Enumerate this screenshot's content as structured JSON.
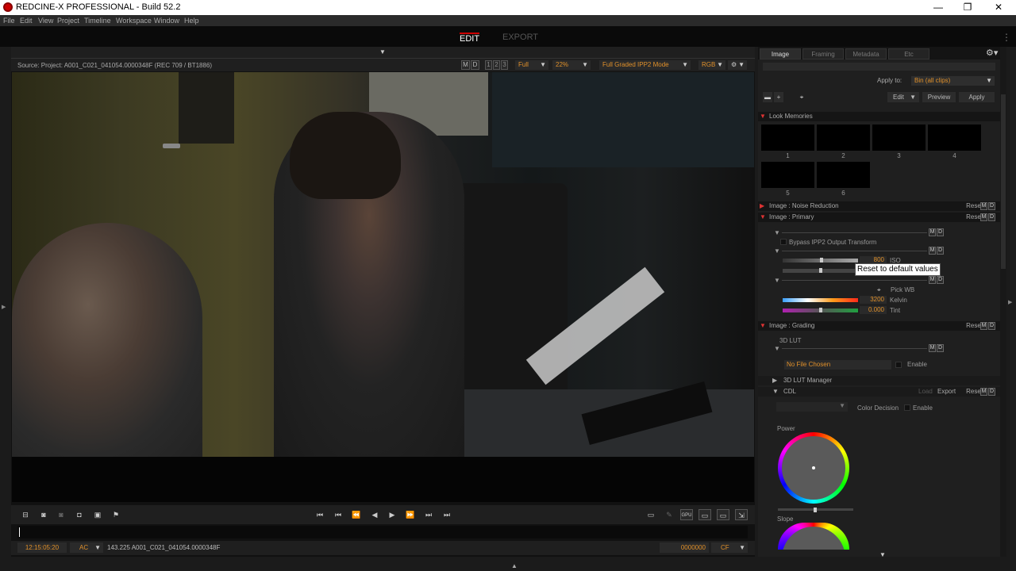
{
  "window": {
    "title": "REDCINE-X PROFESSIONAL - Build 52.2",
    "minimize": "—",
    "maximize": "❐",
    "close": "✕"
  },
  "menu": [
    "File",
    "Edit",
    "View",
    "Project",
    "Timeline",
    "Workspace",
    "Window",
    "Help"
  ],
  "modes": {
    "edit": "EDIT",
    "export": "EXPORT"
  },
  "viewer": {
    "source": "Source: Project: A001_C021_041054.0000348F   (REC 709 / BT1886)",
    "m": "M",
    "d": "D",
    "n1": "1",
    "n2": "2",
    "n3": "3",
    "resolution": "Full",
    "zoom": "22%",
    "mode": "Full Graded IPP2 Mode",
    "color": "RGB"
  },
  "footer": {
    "timecode": "12:15:05:20",
    "ac": "AC",
    "clipinfo": "143.225 A001_C021_041054.0000348F",
    "frame": "0000000",
    "cf": "CF"
  },
  "panel": {
    "tabs": [
      "Image",
      "Framing",
      "Metadata",
      "Etc"
    ],
    "apply_to_label": "Apply to:",
    "apply_to_value": "Bin (all clips)",
    "edit": "Edit",
    "preview": "Preview",
    "apply": "Apply",
    "look_memories": "Look Memories",
    "memories": [
      "1",
      "2",
      "3",
      "4",
      "5",
      "6"
    ],
    "noise": "Image : Noise Reduction",
    "primary": "Image : Primary",
    "grading": "Image : Grading",
    "reset": "Reset",
    "bypass": "Bypass IPP2 Output Transform",
    "iso_value": "800",
    "iso_label": "ISO",
    "pick_wb": "Pick WB",
    "kelvin_value": "3200",
    "kelvin_label": "Kelvin",
    "tint_value": "0.000",
    "tint_label": "Tint",
    "lut_3d": "3D LUT",
    "lut_file": "No File Chosen",
    "enable": "Enable",
    "lut_manager": "3D LUT Manager",
    "cdl": "CDL",
    "load": "Load",
    "export": "Export",
    "color_decision": "Color Decision",
    "power": "Power",
    "slope": "Slope"
  },
  "tooltip": "Reset to default values",
  "colors": {
    "accent": "#e0902a",
    "red": "#cc3333"
  }
}
